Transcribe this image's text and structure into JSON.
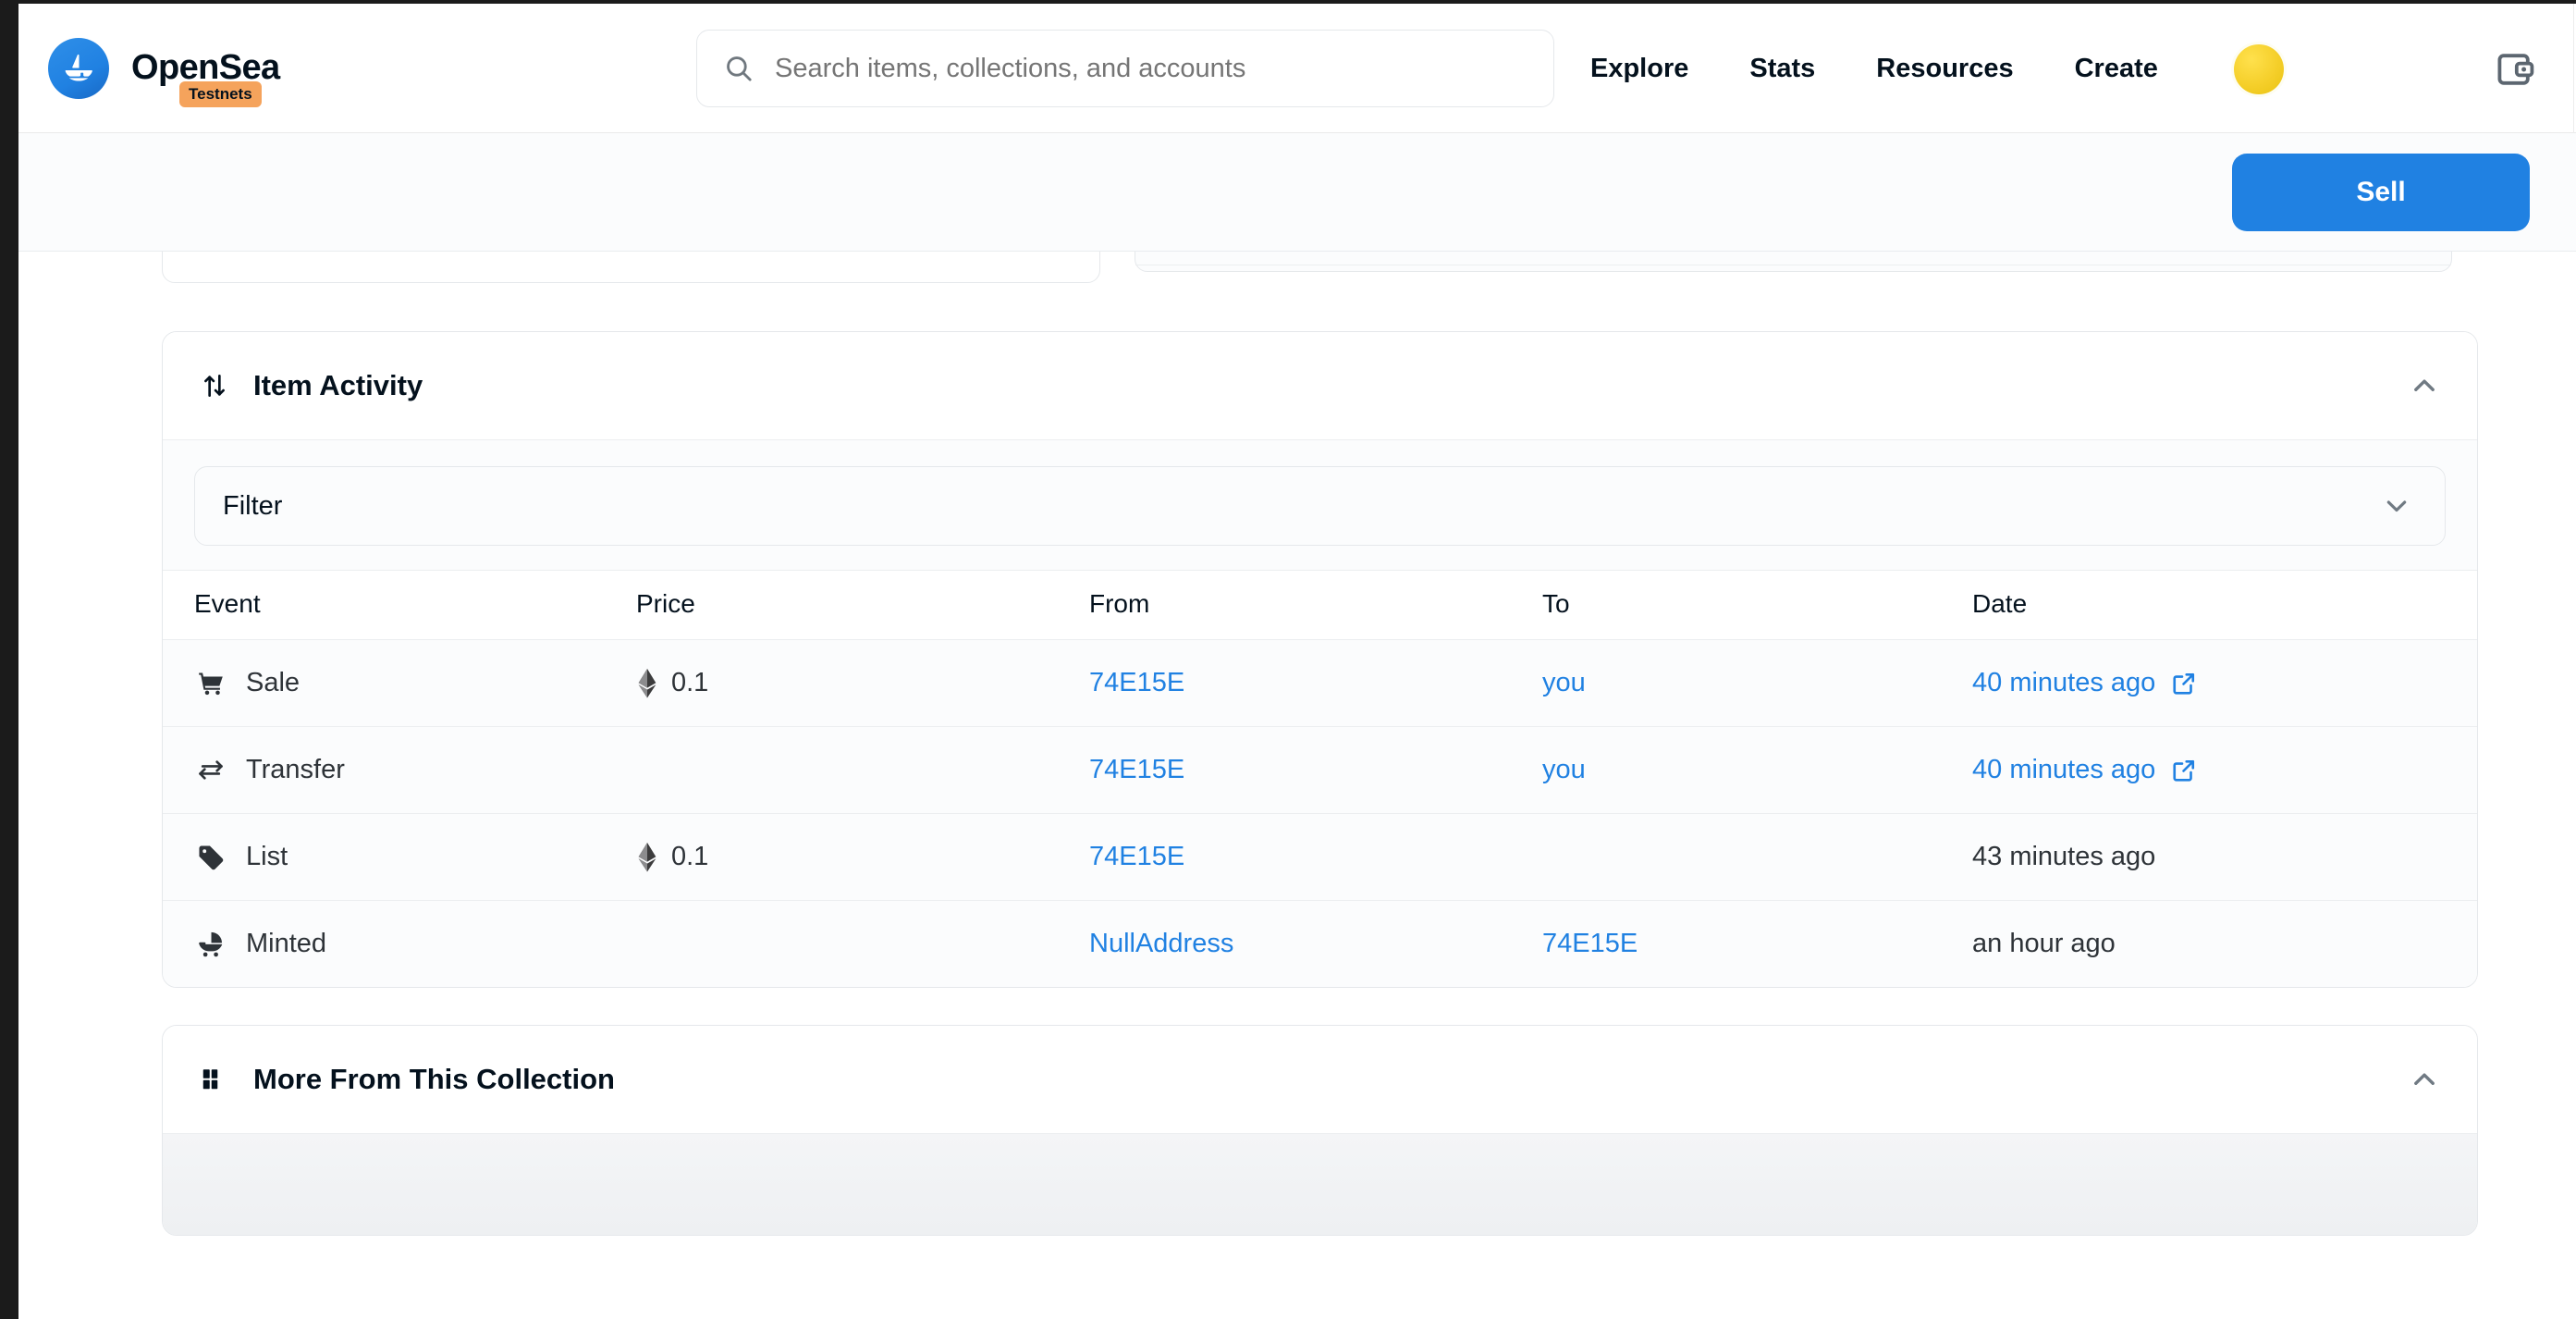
{
  "nav": {
    "brand_name": "OpenSea",
    "brand_badge": "Testnets",
    "logo_icon": "opensea-sailboat-icon",
    "search": {
      "placeholder": "Search items, collections, and accounts",
      "value": "",
      "icon": "search-icon"
    },
    "links": [
      {
        "label": "Explore"
      },
      {
        "label": "Stats"
      },
      {
        "label": "Resources"
      },
      {
        "label": "Create"
      }
    ],
    "avatar_icon": "avatar",
    "wallet_icon": "wallet-icon"
  },
  "actionbar": {
    "sell_label": "Sell"
  },
  "item_activity": {
    "title": "Item Activity",
    "header_icon": "sort-arrows-icon",
    "collapse_icon": "chevron-up-icon",
    "filter": {
      "label": "Filter",
      "chevron_icon": "chevron-down-icon"
    },
    "columns": [
      "Event",
      "Price",
      "From",
      "To",
      "Date"
    ],
    "rows": [
      {
        "event": "Sale",
        "event_icon": "shopping-cart-icon",
        "price": "0.1",
        "price_icon": "ethereum-icon",
        "from": "74E15E",
        "from_is_link": true,
        "to": "you",
        "to_is_link": true,
        "date": "40 minutes ago",
        "date_is_link": true,
        "date_icon": "external-link-icon"
      },
      {
        "event": "Transfer",
        "event_icon": "transfer-arrows-icon",
        "price": "",
        "price_icon": "",
        "from": "74E15E",
        "from_is_link": true,
        "to": "you",
        "to_is_link": true,
        "date": "40 minutes ago",
        "date_is_link": true,
        "date_icon": "external-link-icon"
      },
      {
        "event": "List",
        "event_icon": "price-tag-icon",
        "price": "0.1",
        "price_icon": "ethereum-icon",
        "from": "74E15E",
        "from_is_link": true,
        "to": "",
        "to_is_link": false,
        "date": "43 minutes ago",
        "date_is_link": false,
        "date_icon": ""
      },
      {
        "event": "Minted",
        "event_icon": "stroller-icon",
        "price": "",
        "price_icon": "",
        "from": "NullAddress",
        "from_is_link": true,
        "to": "74E15E",
        "to_is_link": true,
        "date": "an hour ago",
        "date_is_link": false,
        "date_icon": ""
      }
    ]
  },
  "more_collection": {
    "title": "More From This Collection",
    "header_icon": "grid-icon",
    "collapse_icon": "chevron-up-icon"
  },
  "colors": {
    "accent_blue": "#2081e2",
    "badge_orange": "#f5a35c",
    "text_dark": "#04111d",
    "text_muted": "#8a939b",
    "avatar_yellow": "#f5cf2a"
  }
}
